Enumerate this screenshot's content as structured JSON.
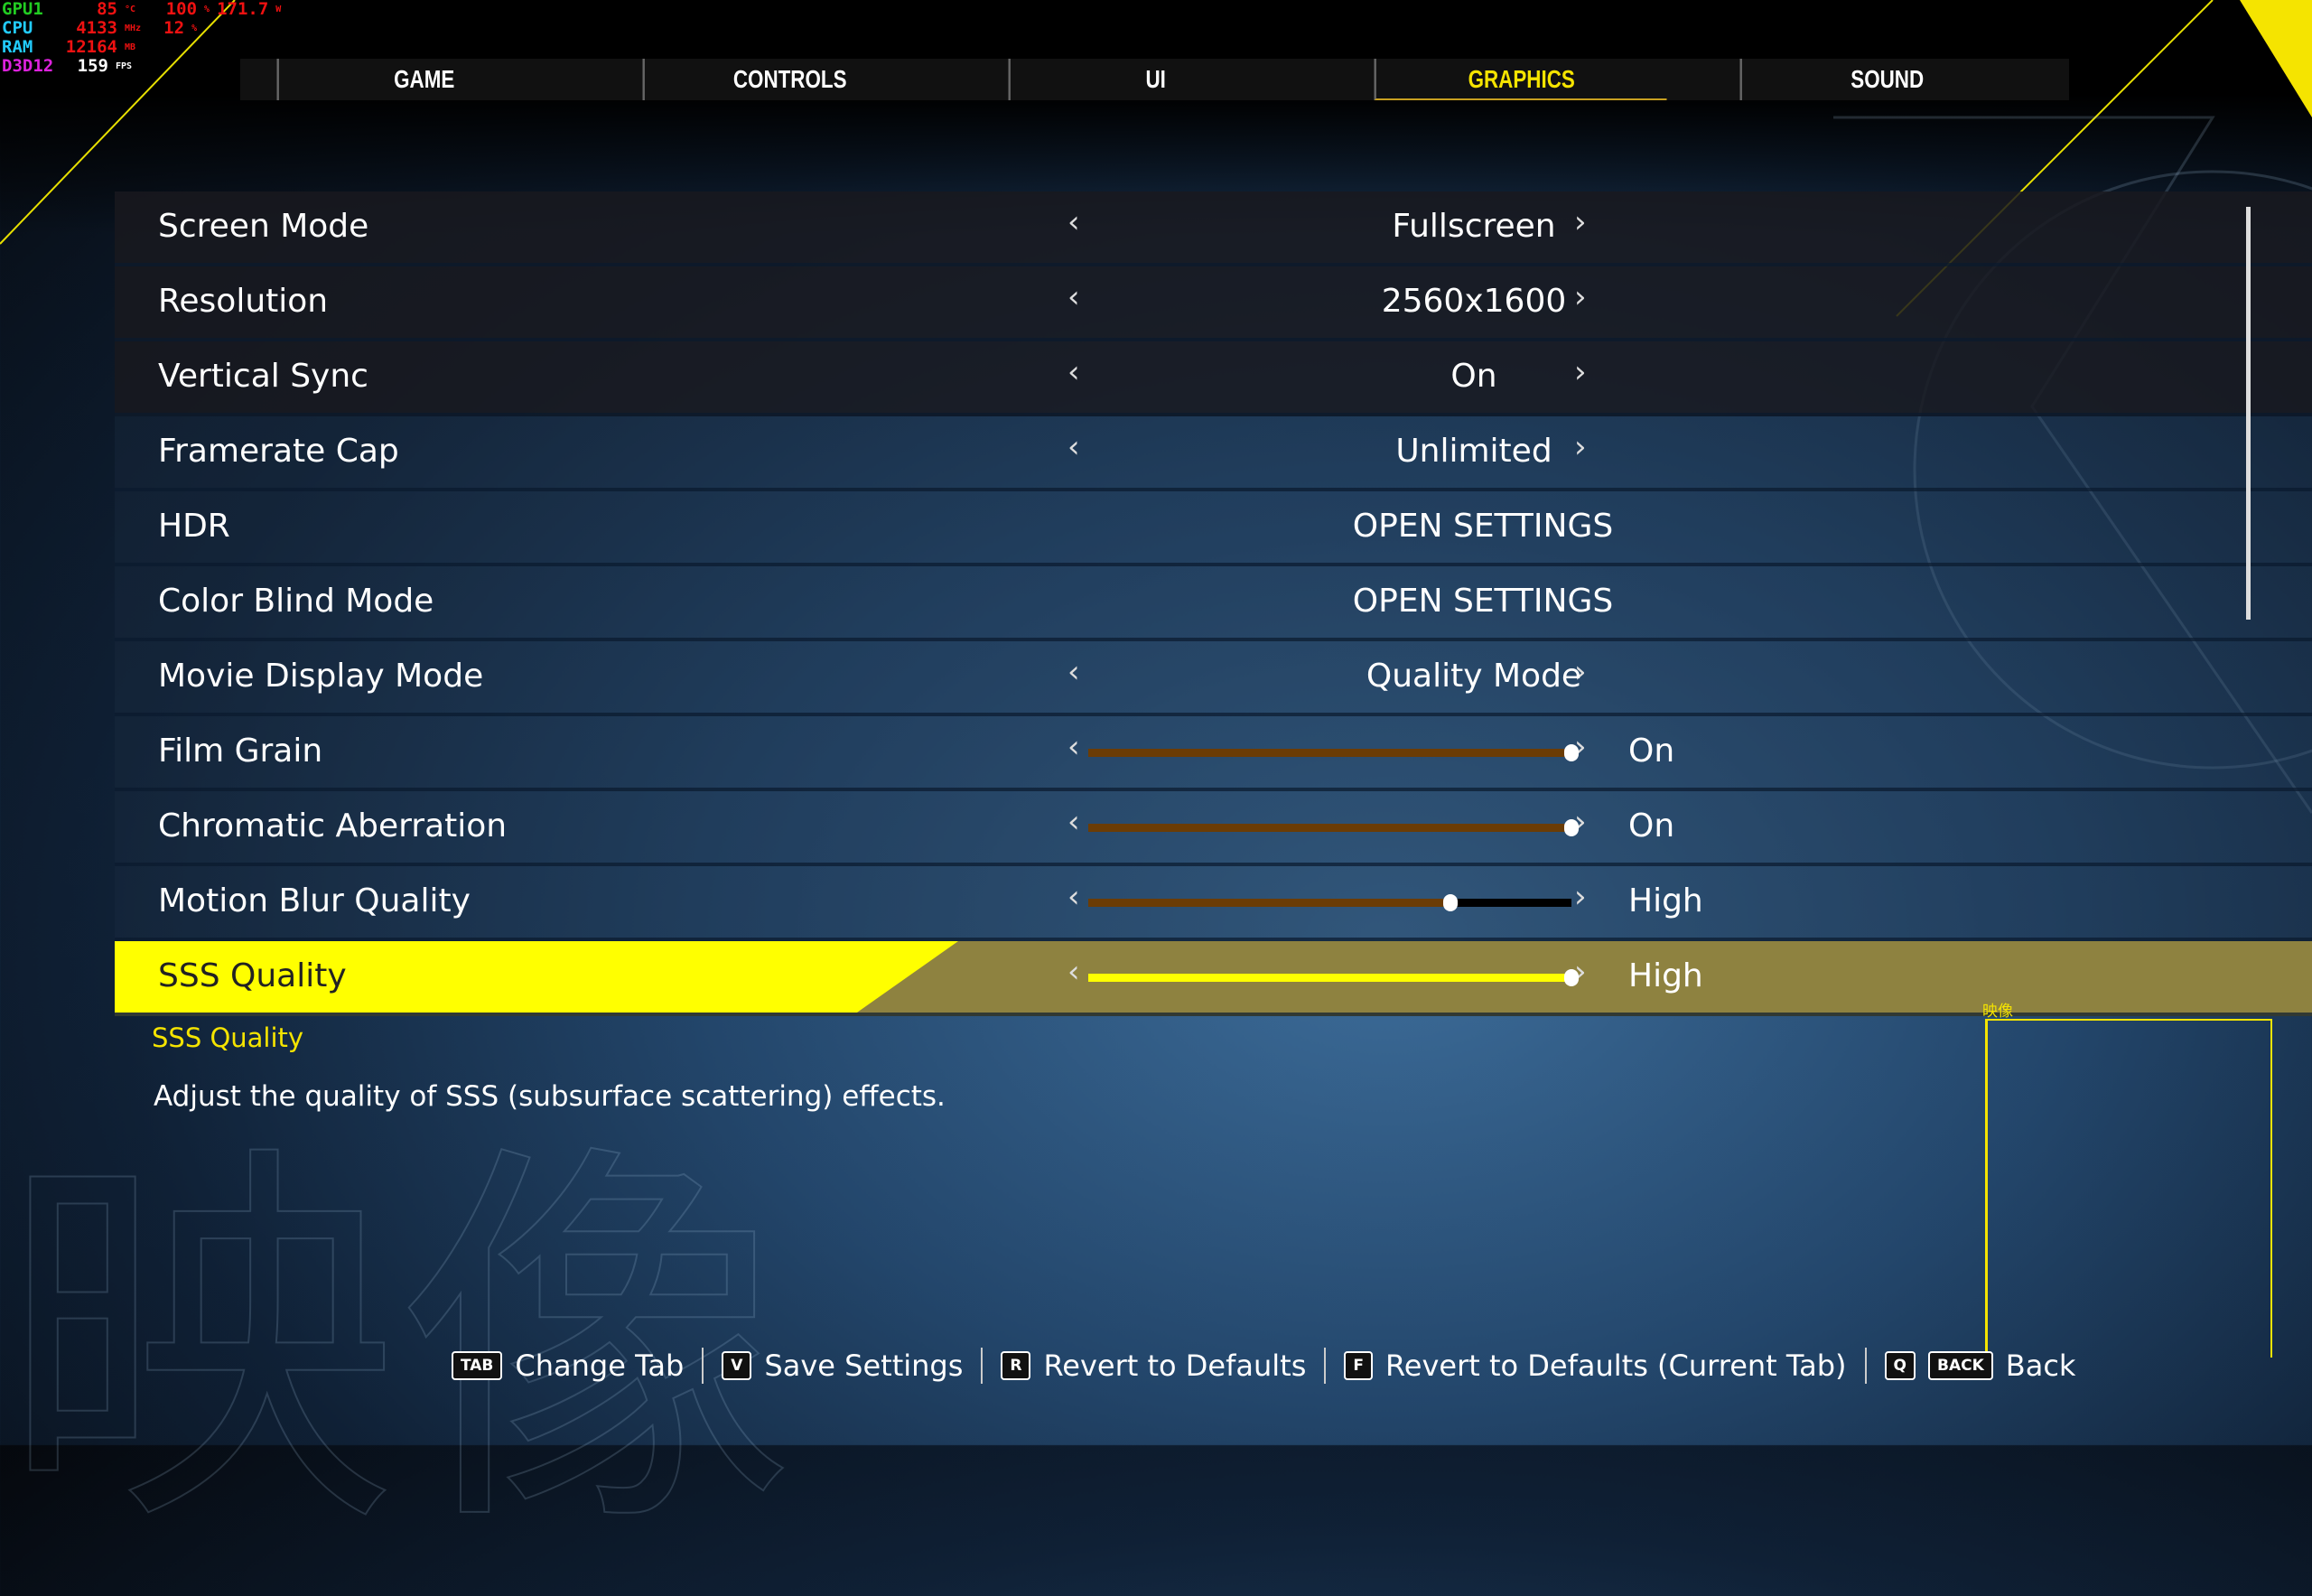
{
  "overlay": {
    "gpu": {
      "label": "GPU1",
      "temp": "85",
      "temp_unit": "°C",
      "load": "100",
      "load_unit": "%",
      "power": "171.7",
      "power_unit": "W"
    },
    "cpu": {
      "label": "CPU",
      "clock": "4133",
      "clock_unit": "MHz",
      "load": "12",
      "load_unit": "%"
    },
    "ram": {
      "label": "RAM",
      "value": "12164",
      "unit": "MB"
    },
    "api": {
      "label": "D3D12",
      "fps": "159",
      "unit": "FPS"
    }
  },
  "tabs": [
    {
      "label": "GAME"
    },
    {
      "label": "CONTROLS"
    },
    {
      "label": "UI"
    },
    {
      "label": "GRAPHICS",
      "active": true
    },
    {
      "label": "SOUND"
    }
  ],
  "settings": [
    {
      "label": "Screen Mode",
      "value": "Fullscreen"
    },
    {
      "label": "Resolution",
      "value": "2560x1600"
    },
    {
      "label": "Vertical Sync",
      "value": "On"
    },
    {
      "label": "Framerate Cap",
      "value": "Unlimited"
    },
    {
      "label": "HDR",
      "value": "OPEN SETTINGS"
    },
    {
      "label": "Color Blind Mode",
      "value": "OPEN SETTINGS"
    },
    {
      "label": "Movie Display Mode",
      "value": "Quality Mode"
    },
    {
      "label": "Film Grain",
      "value": "On",
      "slider": 1.0
    },
    {
      "label": "Chromatic Aberration",
      "value": "On",
      "slider": 1.0
    },
    {
      "label": "Motion Blur Quality",
      "value": "High",
      "slider": 0.75
    },
    {
      "label": "SSS Quality",
      "value": "High",
      "slider": 1.0,
      "selected": true
    }
  ],
  "description": {
    "title": "SSS Quality",
    "text": "Adjust the quality of SSS (subsurface scattering) effects."
  },
  "background_kanji": "映像",
  "section_jp": "映像",
  "hints": [
    {
      "keys": [
        "TAB"
      ],
      "label": "Change Tab"
    },
    {
      "keys": [
        "V"
      ],
      "label": "Save Settings"
    },
    {
      "keys": [
        "R"
      ],
      "label": "Revert to Defaults"
    },
    {
      "keys": [
        "F"
      ],
      "label": "Revert to Defaults (Current Tab)"
    },
    {
      "keys": [
        "Q",
        "BACK"
      ],
      "label": "Back"
    }
  ],
  "colors": {
    "accent": "#ffff00",
    "slider_fill": "#6b3c05",
    "selected_row": "#8e8240"
  }
}
